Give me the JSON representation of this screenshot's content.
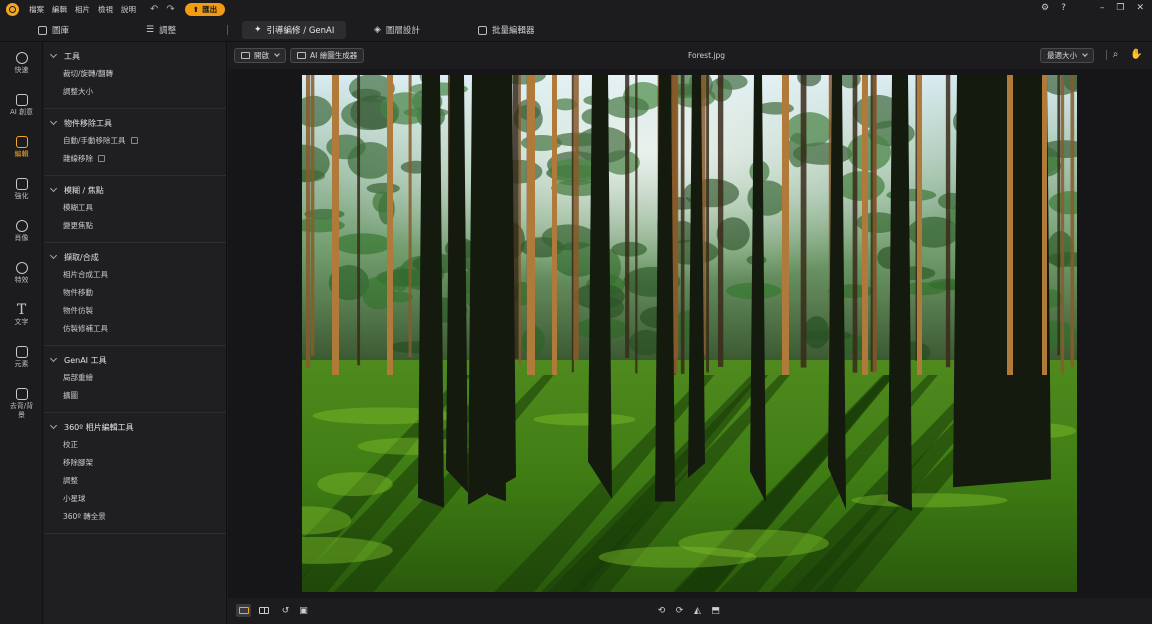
{
  "app": {
    "menu": [
      "檔案",
      "編輯",
      "相片",
      "檢視",
      "說明"
    ],
    "export_label": "匯出",
    "accent": "#f5a623"
  },
  "mode_tabs": [
    {
      "label": "圖庫",
      "icon": "gallery-icon"
    },
    {
      "label": "調整",
      "icon": "sliders-icon"
    },
    {
      "label": "引導編修 / GenAI",
      "icon": "magic-wand-icon",
      "active": true
    },
    {
      "label": "圖層設計",
      "icon": "layers-icon"
    },
    {
      "label": "批量編輯器",
      "icon": "batch-icon"
    }
  ],
  "rail": [
    {
      "label": "快速",
      "icon": "quick-icon"
    },
    {
      "label": "AI 創意",
      "icon": "ai-creative-icon"
    },
    {
      "label": "編輯",
      "icon": "edit-icon",
      "active": true
    },
    {
      "label": "強化",
      "icon": "enhance-icon"
    },
    {
      "label": "肖像",
      "icon": "portrait-icon"
    },
    {
      "label": "特效",
      "icon": "effects-icon"
    },
    {
      "label": "文字",
      "icon": "text-icon"
    },
    {
      "label": "元素",
      "icon": "elements-icon"
    },
    {
      "label": "去背/背景",
      "icon": "background-icon"
    }
  ],
  "panel": {
    "sections": [
      {
        "title": "工具",
        "items": [
          "裁切/旋轉/翻轉",
          "調整大小"
        ]
      },
      {
        "title": "物件移除工具",
        "items": [
          "自動/手動移除工具",
          "雜線移除"
        ]
      },
      {
        "title": "模糊 / 焦點",
        "items": [
          "模糊工具",
          "變更焦點"
        ]
      },
      {
        "title": "擷取/合成",
        "items": [
          "相片合成工具",
          "物件移動",
          "物件仿製",
          "仿製修補工具"
        ]
      },
      {
        "title": "GenAI 工具",
        "items": [
          "局部重繪",
          "擴圖"
        ]
      },
      {
        "title": "360º 相片編輯工具",
        "items": [
          "校正",
          "移除腳架",
          "調整",
          "小星球",
          "360º 轉全景"
        ]
      }
    ]
  },
  "canvas": {
    "open_label": "開啟",
    "ai_generator_label": "AI 繪圖生成器",
    "filename": "Forest.jpg",
    "zoom_label": "最適大小"
  }
}
